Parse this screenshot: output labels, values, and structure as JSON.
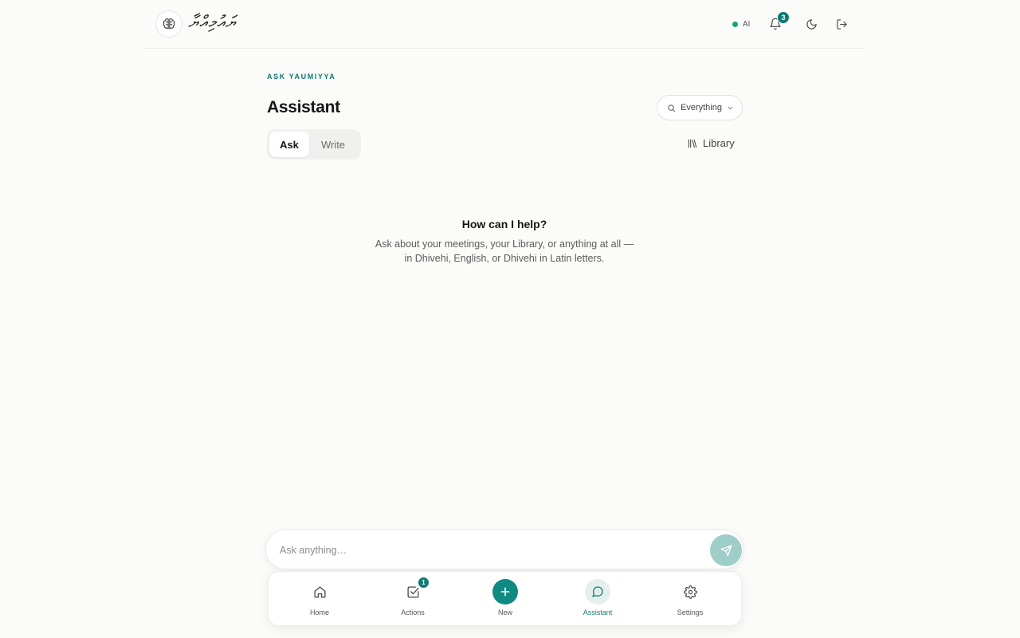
{
  "header": {
    "brand_wordmark": "ޔައުމިއްޔާ",
    "ai_status_label": "AI",
    "notification_count": "3",
    "colors": {
      "accent": "#0f7a73",
      "status_dot": "#17a673"
    }
  },
  "main": {
    "eyebrow": "ASK YAUMIYYA",
    "title": "Assistant",
    "scope_select": {
      "selected": "Everything"
    },
    "tabs": [
      {
        "label": "Ask",
        "active": true
      },
      {
        "label": "Write",
        "active": false
      }
    ],
    "library_link": "Library",
    "empty_state": {
      "title": "How can I help?",
      "line1": "Ask about your meetings, your Library, or anything at all —",
      "line2": "in Dhivehi, English, or Dhivehi in Latin letters."
    }
  },
  "composer": {
    "placeholder": "Ask anything…",
    "value": ""
  },
  "bottom_nav": {
    "items": [
      {
        "label": "Home",
        "icon": "home-icon",
        "active": false
      },
      {
        "label": "Actions",
        "icon": "checkbox-icon",
        "badge": "1",
        "active": false
      },
      {
        "label": "New",
        "icon": "plus-icon",
        "active": false
      },
      {
        "label": "Assistant",
        "icon": "chat-bubble-icon",
        "active": true
      },
      {
        "label": "Settings",
        "icon": "gear-icon",
        "active": false
      }
    ]
  }
}
